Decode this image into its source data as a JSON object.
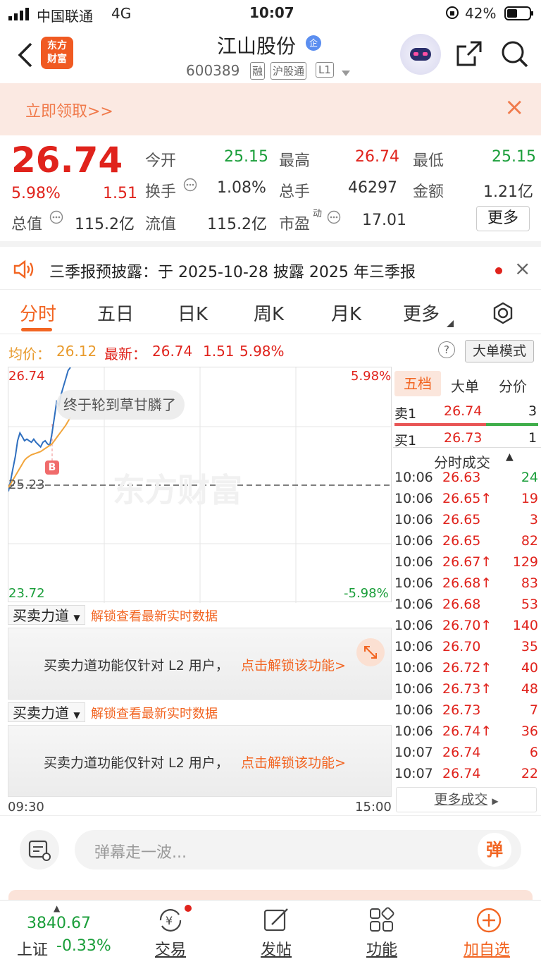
{
  "status_bar": {
    "carrier": "中国联通",
    "network": "4G",
    "time": "10:07",
    "battery": "42%"
  },
  "header": {
    "back_icon": "chevron-left-icon",
    "logo_line1": "东方",
    "logo_line2": "财富",
    "title": "江山股份",
    "title_badge": "企",
    "code": "600389",
    "tags": [
      "融",
      "沪股通",
      "L1"
    ],
    "share_icon": "share-icon",
    "search_icon": "search-icon"
  },
  "banner": {
    "text": "立即领取>>",
    "close": "×"
  },
  "quote": {
    "price": "26.74",
    "change_pct": "5.98%",
    "change": "1.51",
    "fields": [
      {
        "label": "今开",
        "value": "25.15",
        "color": "green"
      },
      {
        "label": "最高",
        "value": "26.74",
        "color": "red"
      },
      {
        "label": "最低",
        "value": "25.15",
        "color": "green"
      },
      {
        "label": "换手",
        "value": "1.08%",
        "color": "dark"
      },
      {
        "label": "总手",
        "value": "46297",
        "color": "dark"
      },
      {
        "label": "金额",
        "value": "1.21亿",
        "color": "dark"
      },
      {
        "label": "总值",
        "value": "115.2亿",
        "color": "dark"
      },
      {
        "label": "流值",
        "value": "115.2亿",
        "color": "dark"
      },
      {
        "label": "市盈",
        "value": "17.01",
        "color": "dark"
      }
    ],
    "pe_superscript": "动",
    "more_button": "更多"
  },
  "notice": {
    "text": "三季报预披露：于 2025-10-28 披露 2025 年三季报",
    "close": "×"
  },
  "tabs": {
    "items": [
      "分时",
      "五日",
      "日K",
      "周K",
      "月K",
      "更多"
    ],
    "active": 0,
    "settings_icon": "gear-icon"
  },
  "price_line": {
    "avg_label": "均价：",
    "avg_value": "26.12",
    "latest_label": "最新：",
    "latest_value": "26.74",
    "change": "1.51",
    "change_pct": "5.98%",
    "help_icon": "?",
    "big_order_mode": "大单模式"
  },
  "chart": {
    "y_top": "26.74",
    "y_mid": "25.23",
    "y_bottom": "23.72",
    "pct_top": "5.98%",
    "pct_bottom": "-5.98%",
    "watermark": "东方财富",
    "bubble": "终于轮到草甘膦了",
    "marker": "B",
    "x_start": "09:30",
    "x_end": "15:00"
  },
  "chart_data": {
    "type": "line",
    "ylim": [
      23.72,
      26.74
    ],
    "x": [
      0,
      1,
      2,
      3,
      4,
      5,
      6,
      7,
      8,
      9,
      10,
      11,
      12,
      13,
      14,
      15,
      16,
      17,
      18,
      19,
      20,
      21,
      22,
      23,
      24,
      25,
      26,
      27
    ],
    "series": [
      {
        "values": [
          25.15,
          25.3,
          25.45,
          25.6,
          25.8,
          25.9,
          25.85,
          25.8,
          25.82,
          25.8,
          25.78,
          25.82,
          25.78,
          25.75,
          25.72,
          25.78,
          25.8,
          25.76,
          25.74,
          25.9,
          26.1,
          26.3,
          26.25,
          26.4,
          26.5,
          26.6,
          26.7,
          26.74
        ],
        "color": "#2f6fbf"
      },
      {
        "values": [
          25.2,
          25.25,
          25.3,
          25.35,
          25.4,
          25.45,
          25.5,
          25.55,
          25.58,
          25.6,
          25.62,
          25.63,
          25.64,
          25.65,
          25.66,
          25.68,
          25.7,
          25.72,
          25.74,
          25.76,
          25.8,
          25.84,
          25.88,
          25.92,
          25.96,
          26.0,
          26.05,
          26.1
        ],
        "color": "#f2a53b"
      }
    ]
  },
  "flow": [
    {
      "label": "买卖力道",
      "link": "解锁查看最新实时数据",
      "msg": "买卖力道功能仅针对 L2 用户，",
      "action": "点击解锁该功能>"
    },
    {
      "label": "买卖力道",
      "link": "解锁查看最新实时数据",
      "msg": "买卖力道功能仅针对 L2 用户，",
      "action": "点击解锁该功能>"
    }
  ],
  "right_panel": {
    "tabs": [
      "五档",
      "大单",
      "分价"
    ],
    "sell1": {
      "label": "卖1",
      "price": "26.74",
      "vol": "3"
    },
    "buy1": {
      "label": "买1",
      "price": "26.73",
      "vol": "1"
    },
    "trades_title": "分时成交",
    "trades": [
      {
        "time": "10:06",
        "price": "26.63",
        "vol": "24",
        "up": false,
        "vc": "green"
      },
      {
        "time": "10:06",
        "price": "26.65↑",
        "vol": "19",
        "up": true,
        "vc": "red"
      },
      {
        "time": "10:06",
        "price": "26.65",
        "vol": "3",
        "up": false,
        "vc": "red"
      },
      {
        "time": "10:06",
        "price": "26.65",
        "vol": "82",
        "up": false,
        "vc": "red"
      },
      {
        "time": "10:06",
        "price": "26.67↑",
        "vol": "129",
        "up": true,
        "vc": "red"
      },
      {
        "time": "10:06",
        "price": "26.68↑",
        "vol": "83",
        "up": true,
        "vc": "red"
      },
      {
        "time": "10:06",
        "price": "26.68",
        "vol": "53",
        "up": false,
        "vc": "red"
      },
      {
        "time": "10:06",
        "price": "26.70↑",
        "vol": "140",
        "up": true,
        "vc": "red"
      },
      {
        "time": "10:06",
        "price": "26.70",
        "vol": "35",
        "up": false,
        "vc": "red"
      },
      {
        "time": "10:06",
        "price": "26.72↑",
        "vol": "40",
        "up": true,
        "vc": "red"
      },
      {
        "time": "10:06",
        "price": "26.73↑",
        "vol": "48",
        "up": true,
        "vc": "red"
      },
      {
        "time": "10:06",
        "price": "26.73",
        "vol": "7",
        "up": false,
        "vc": "red"
      },
      {
        "time": "10:06",
        "price": "26.74↑",
        "vol": "36",
        "up": true,
        "vc": "red"
      },
      {
        "time": "10:07",
        "price": "26.74",
        "vol": "6",
        "up": false,
        "vc": "red"
      },
      {
        "time": "10:07",
        "price": "26.74",
        "vol": "22",
        "up": false,
        "vc": "red"
      }
    ],
    "more_trades": "更多成交"
  },
  "danmu": {
    "placeholder": "弹幕走一波...",
    "send": "弹"
  },
  "nav": {
    "index_value": "3840.67",
    "index_name": "上证",
    "index_change": "-0.33%",
    "items": [
      {
        "label": "交易",
        "icon": "yen-exchange-icon"
      },
      {
        "label": "发帖",
        "icon": "edit-icon"
      },
      {
        "label": "功能",
        "icon": "apps-grid-icon"
      },
      {
        "label": "加自选",
        "icon": "plus-circle-icon"
      }
    ]
  }
}
